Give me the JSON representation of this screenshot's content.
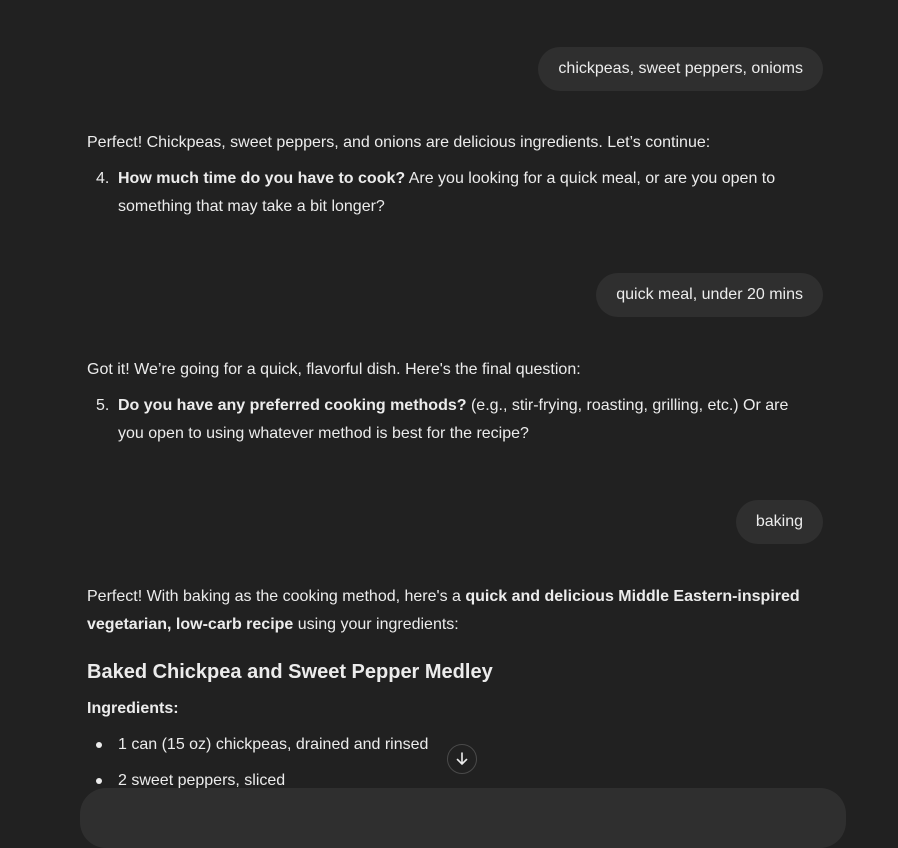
{
  "conversation": {
    "user1": "chickpeas, sweet peppers, onioms",
    "assistant1_intro": "Perfect! Chickpeas, sweet peppers, and onions are delicious ingredients. Let’s continue:",
    "q4": {
      "number": "4.",
      "bold": "How much time do you have to cook?",
      "rest": " Are you looking for a quick meal, or are you open to something that may take a bit longer?"
    },
    "user2": "quick meal, under 20 mins",
    "assistant2_intro": "Got it! We’re going for a quick, flavorful dish. Here's the final question:",
    "q5": {
      "number": "5.",
      "bold": "Do you have any preferred cooking methods?",
      "rest": " (e.g., stir-frying, roasting, grilling, etc.) Or are you open to using whatever method is best for the recipe?"
    },
    "user3": "baking",
    "assistant3": {
      "intro_a": "Perfect! With baking as the cooking method, here's a ",
      "intro_bold": "quick and delicious Middle Eastern-inspired vegetarian, low-carb recipe",
      "intro_b": " using your ingredients:",
      "recipe_title": "Baked Chickpea and Sweet Pepper Medley",
      "ingredients_label": "Ingredients:",
      "ingredients": [
        "1 can (15 oz) chickpeas, drained and rinsed",
        "2 sweet peppers, sliced"
      ]
    }
  },
  "icons": {
    "scroll_down": "arrow-down-icon"
  }
}
